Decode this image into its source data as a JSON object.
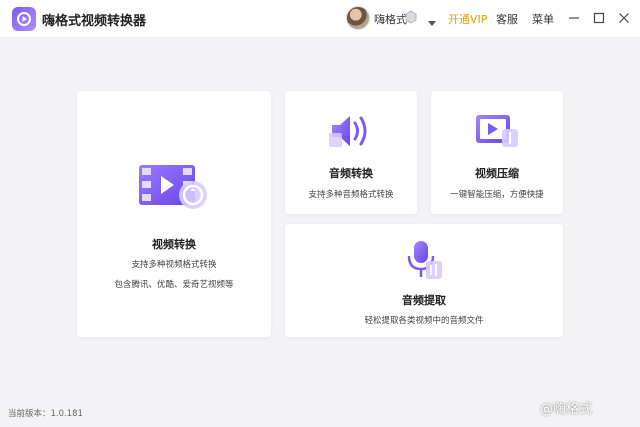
{
  "app": {
    "title": "嗨格式视频转换器",
    "logo_icon": "app-logo-icon"
  },
  "header": {
    "username": "嗨格式",
    "vip_label": "开通VIP",
    "service_label": "客服",
    "menu_label": "菜单",
    "vip_color": "#e3a400"
  },
  "cards": {
    "video": {
      "title": "视频转换",
      "desc1": "支持多种视频格式转换",
      "desc2": "包含腾讯、优酷、爱奇艺视频等",
      "icon": "video-convert-icon"
    },
    "audio": {
      "title": "音频转换",
      "desc": "支持多种音频格式转换",
      "icon": "audio-convert-icon"
    },
    "compress": {
      "title": "视频压缩",
      "desc": "一键智能压缩，方便快捷",
      "icon": "video-compress-icon"
    },
    "extract": {
      "title": "音频提取",
      "desc": "轻松提取各类视频中的音频文件",
      "icon": "microphone-icon"
    }
  },
  "footer": {
    "version": "当前版本：1.0.181",
    "watermark": "@嗨格式"
  },
  "colors": {
    "accent": "#7a5cf5",
    "accent_light": "#c9b8ff"
  }
}
